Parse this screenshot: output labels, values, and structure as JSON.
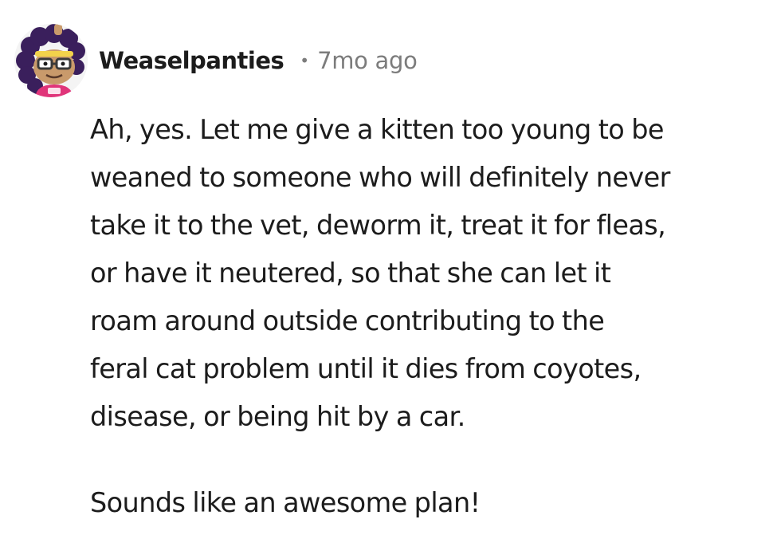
{
  "comment": {
    "author": {
      "username": "Weaselpanties",
      "avatar_icon": "snoo-avatar-icon"
    },
    "separator": "•",
    "timestamp": "7mo ago",
    "paragraphs": [
      "Ah, yes. Let me give a kitten too young to be\nweaned to someone who will definitely never\ntake it to the vet, deworm it, treat it for fleas,\nor have it neutered, so that she can let it\nroam around outside contributing to the\nferal cat problem until it dies from coyotes,\ndisease, or being hit by a car.",
      "Sounds like an awesome plan!"
    ]
  },
  "colors": {
    "text": "#1c1c1c",
    "meta": "#7c7c7c",
    "avatar_hair": "#3a1f5c",
    "avatar_shirt": "#e0357a",
    "avatar_headband": "#f2d24b"
  }
}
